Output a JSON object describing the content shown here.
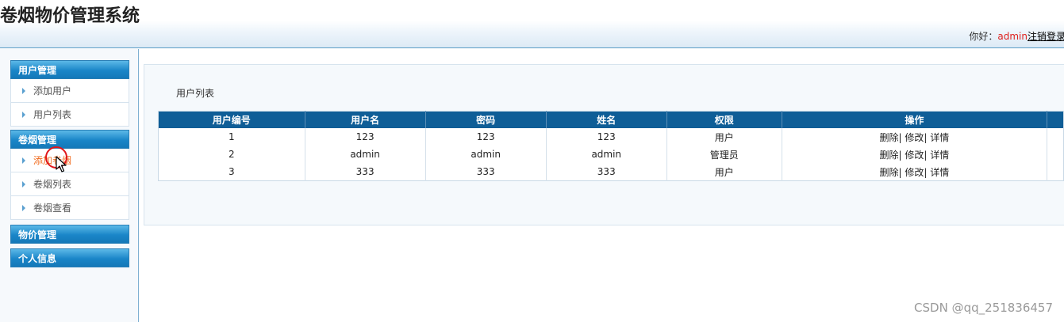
{
  "header": {
    "app_title": "卷烟物价管理系统",
    "greeting": "你好：",
    "username": "admin",
    "logout_label": "注销登录"
  },
  "sidebar": {
    "groups": [
      {
        "title": "用户管理",
        "items": [
          "添加用户",
          "用户列表"
        ]
      },
      {
        "title": "卷烟管理",
        "items": [
          "添加卷烟",
          "卷烟列表",
          "卷烟查看"
        ]
      },
      {
        "title": "物价管理",
        "items": []
      },
      {
        "title": "个人信息",
        "items": []
      }
    ],
    "active_item": "添加卷烟"
  },
  "main": {
    "section_title": "用户列表",
    "table": {
      "columns": [
        "用户编号",
        "用户名",
        "密码",
        "姓名",
        "权限",
        "操作"
      ],
      "rows": [
        [
          "1",
          "123",
          "123",
          "123",
          "用户"
        ],
        [
          "2",
          "admin",
          "admin",
          "admin",
          "管理员"
        ],
        [
          "3",
          "333",
          "333",
          "333",
          "用户"
        ]
      ],
      "actions": {
        "delete": "删除|",
        "edit": "修改|",
        "detail": "详情"
      }
    }
  },
  "watermark": "CSDN @qq_251836457",
  "colors": {
    "header_bar": "#0f5e97",
    "menu_header": "#1a86c8",
    "active_item": "#f06a1c",
    "username": "#e0231f"
  }
}
